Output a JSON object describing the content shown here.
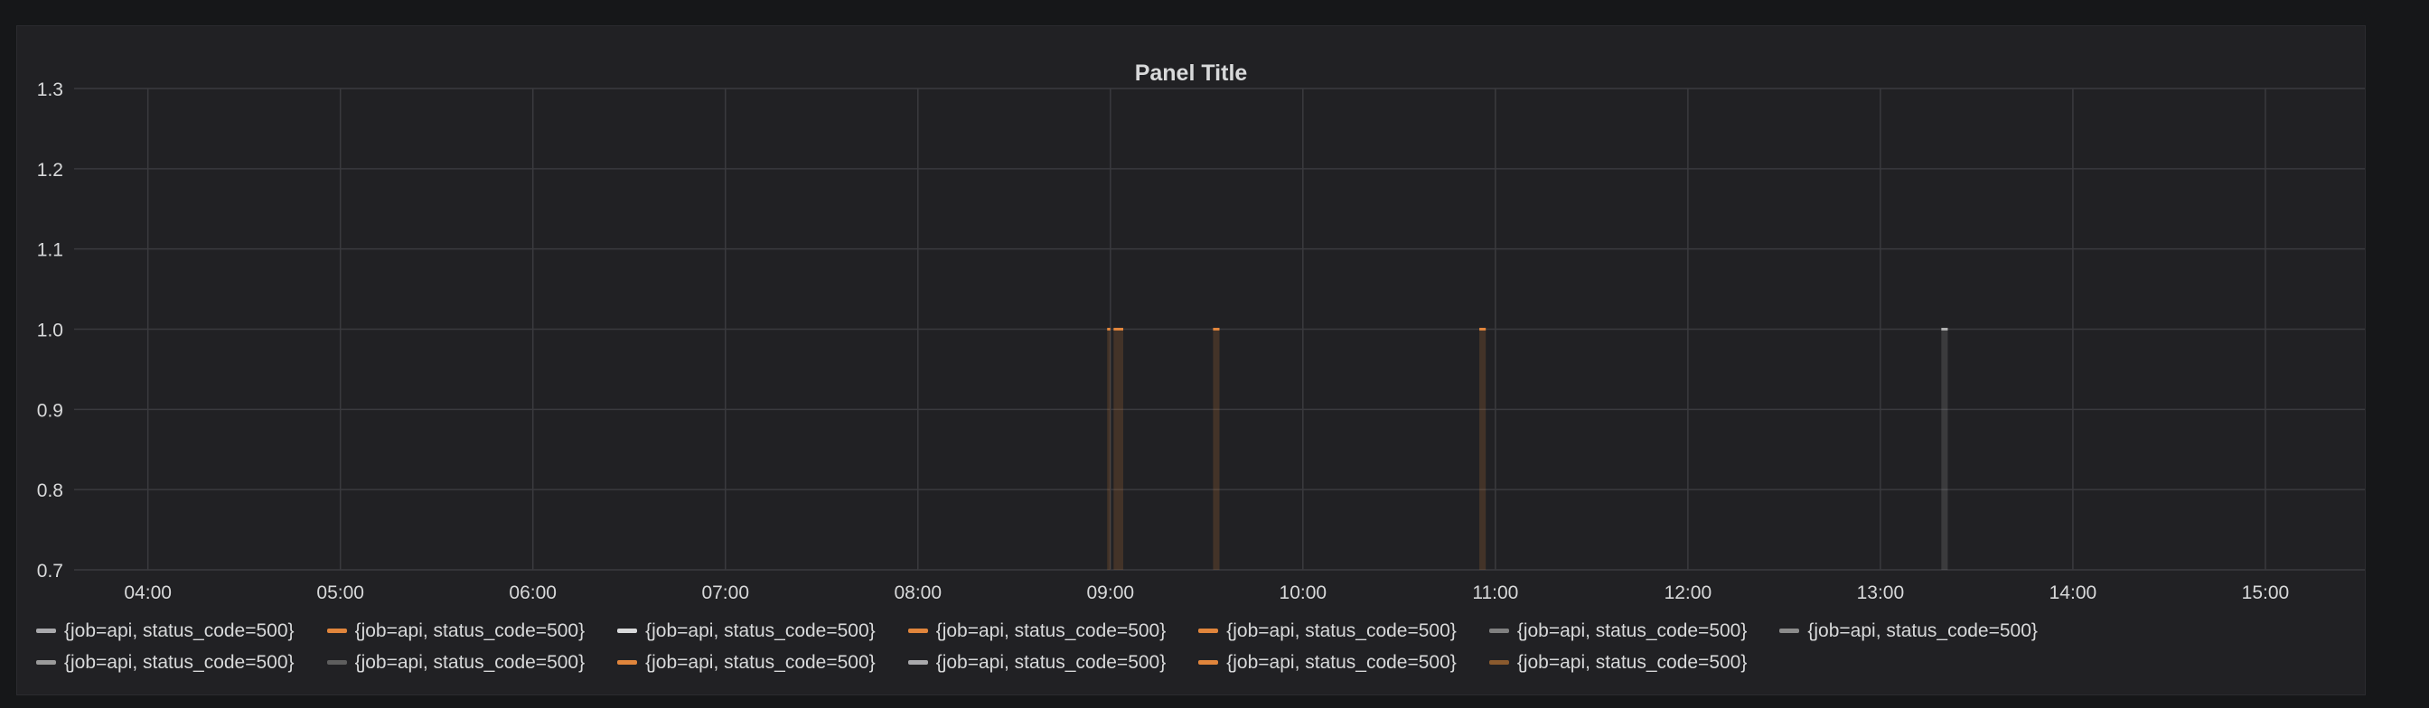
{
  "panel": {
    "title": "Panel Title"
  },
  "colors": {
    "background": "#161719",
    "panel": "#212124",
    "grid": "#3a3a3e",
    "gray": "#a9a9ac",
    "orange": "#e0853c",
    "text": "#d8d9da"
  },
  "chart_data": {
    "type": "area",
    "title": "Panel Title",
    "xlabel": "",
    "ylabel": "",
    "x_ticks": [
      "04:00",
      "05:00",
      "06:00",
      "07:00",
      "08:00",
      "09:00",
      "10:00",
      "11:00",
      "12:00",
      "13:00",
      "14:00",
      "15:00"
    ],
    "xlim": [
      "03:37",
      "15:31"
    ],
    "y_ticks": [
      "0.7",
      "0.8",
      "0.9",
      "1.0",
      "1.1",
      "1.2",
      "1.3"
    ],
    "ylim": [
      0.7,
      1.3
    ],
    "grid": true,
    "legend_position": "bottom",
    "series": [
      {
        "name": "{job=api, status_code=500}",
        "color": "#a9a9ac",
        "points": []
      },
      {
        "name": "{job=api, status_code=500}",
        "color": "#e0853c",
        "points": [
          {
            "x": "08:59",
            "y": 1.0
          },
          {
            "x": "09:00",
            "y": 1.0
          }
        ]
      },
      {
        "name": "{job=api, status_code=500}",
        "color": "#a9a9ac",
        "points": []
      },
      {
        "name": "{job=api, status_code=500}",
        "color": "#e0853c",
        "points": [
          {
            "x": "09:01",
            "y": 1.0
          },
          {
            "x": "09:04",
            "y": 1.0
          }
        ]
      },
      {
        "name": "{job=api, status_code=500}",
        "color": "#e0853c",
        "points": [
          {
            "x": "09:32",
            "y": 1.0
          },
          {
            "x": "09:34",
            "y": 1.0
          }
        ]
      },
      {
        "name": "{job=api, status_code=500}",
        "color": "#808080",
        "points": []
      },
      {
        "name": "{job=api, status_code=500}",
        "color": "#808080",
        "points": []
      },
      {
        "name": "{job=api, status_code=500}",
        "color": "#808080",
        "points": []
      },
      {
        "name": "{job=api, status_code=500}",
        "color": "#606060",
        "points": []
      },
      {
        "name": "{job=api, status_code=500}",
        "color": "#e0853c",
        "points": [
          {
            "x": "10:55",
            "y": 1.0
          },
          {
            "x": "10:57",
            "y": 1.0
          }
        ]
      },
      {
        "name": "{job=api, status_code=500}",
        "color": "#a9a9ac",
        "points": []
      },
      {
        "name": "{job=api, status_code=500}",
        "color": "#e0853c",
        "points": []
      },
      {
        "name": "{job=api, status_code=500}",
        "color": "#8a5a2e",
        "points": []
      },
      {
        "name": "",
        "color": "#b0b0b0",
        "points": [
          {
            "x": "13:19",
            "y": 1.0
          },
          {
            "x": "13:21",
            "y": 1.0
          }
        ]
      }
    ],
    "legend": [
      {
        "label": "{job=api, status_code=500}",
        "color": "#a9a9ac"
      },
      {
        "label": "{job=api, status_code=500}",
        "color": "#e0853c"
      },
      {
        "label": "{job=api, status_code=500}",
        "color": "#d8d9da"
      },
      {
        "label": "{job=api, status_code=500}",
        "color": "#e0853c"
      },
      {
        "label": "{job=api, status_code=500}",
        "color": "#e0853c"
      },
      {
        "label": "{job=api, status_code=500}",
        "color": "#808080"
      },
      {
        "label": "{job=api, status_code=500}",
        "color": "#8c8c8c"
      },
      {
        "label": "{job=api, status_code=500}",
        "color": "#9a9a9a"
      },
      {
        "label": "{job=api, status_code=500}",
        "color": "#5e5e5e"
      },
      {
        "label": "{job=api, status_code=500}",
        "color": "#e0853c"
      },
      {
        "label": "{job=api, status_code=500}",
        "color": "#a9a9ac"
      },
      {
        "label": "{job=api, status_code=500}",
        "color": "#e0853c"
      },
      {
        "label": "{job=api, status_code=500}",
        "color": "#8a5a2e"
      }
    ]
  }
}
